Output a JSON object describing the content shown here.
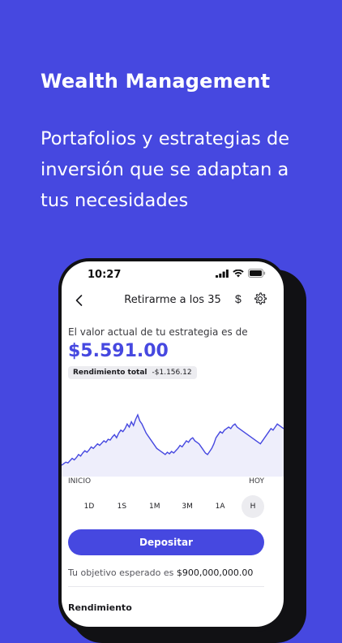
{
  "promo": {
    "title": "Wealth Management",
    "subtitle": "Portafolios y estrategias de inversión que se adaptan a tus necesidades"
  },
  "status_bar": {
    "time": "10:27",
    "icons": [
      "signal-icon",
      "wifi-icon",
      "battery-icon"
    ]
  },
  "nav": {
    "title": "Retirarme a los 35",
    "back_icon": "chevron-left-icon",
    "currency_symbol": "$",
    "settings_icon": "gear-icon"
  },
  "summary": {
    "value_label": "El valor actual de tu estrategia es de",
    "value_amount": "$5.591.00",
    "performance_label": "Rendimiento total",
    "performance_value": "-$1.156.12"
  },
  "chart_data": {
    "type": "area",
    "x_start_label": "INICIO",
    "x_end_label": "HOY",
    "values": [
      38,
      40,
      42,
      41,
      44,
      47,
      45,
      48,
      52,
      50,
      54,
      57,
      55,
      58,
      62,
      60,
      63,
      66,
      64,
      67,
      70,
      68,
      72,
      71,
      75,
      78,
      74,
      80,
      84,
      82,
      86,
      92,
      88,
      95,
      90,
      98,
      104,
      96,
      92,
      86,
      80,
      76,
      72,
      68,
      64,
      60,
      58,
      56,
      54,
      52,
      55,
      53,
      56,
      54,
      57,
      60,
      64,
      62,
      66,
      70,
      68,
      72,
      74,
      70,
      68,
      66,
      62,
      58,
      54,
      52,
      56,
      60,
      66,
      74,
      78,
      82,
      80,
      84,
      86,
      88,
      86,
      90,
      92,
      88,
      86,
      84,
      82,
      80,
      78,
      76,
      74,
      72,
      70,
      68,
      66,
      70,
      74,
      78,
      82,
      86,
      84,
      88,
      92,
      90,
      88,
      86
    ],
    "color": "#4648e0",
    "fill": "#eeeefb"
  },
  "ranges": {
    "items": [
      "1D",
      "1S",
      "1M",
      "3M",
      "1A",
      "H"
    ],
    "selected": "H"
  },
  "actions": {
    "deposit_label": "Depositar"
  },
  "goal": {
    "prefix": "Tu objetivo esperado es",
    "amount": "$900,000,000.00"
  },
  "next_section": {
    "label": "Rendimiento"
  },
  "colors": {
    "background": "#4648e0",
    "accent": "#4648e0"
  }
}
